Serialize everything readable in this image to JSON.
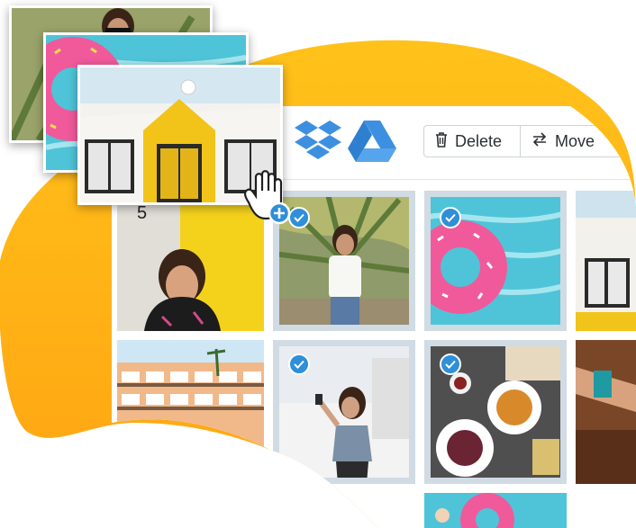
{
  "colors": {
    "blob_top": "#ffc21a",
    "blob_bottom": "#ffa412",
    "accent_blue": "#2f8fd8",
    "selection_border": "#d0dbe4",
    "toolbar_border": "#cfd3d6"
  },
  "toolbar": {
    "services": [
      {
        "name": "dropbox-icon"
      },
      {
        "name": "google-drive-icon"
      }
    ],
    "delete_label": "Delete",
    "delete_icon": "trash-icon",
    "move_label": "Move",
    "move_icon": "swap-arrows-icon"
  },
  "photos": [
    {
      "name": "photo-yellow-wall-woman",
      "selected": false,
      "label": "5"
    },
    {
      "name": "photo-palm-woman",
      "selected": true
    },
    {
      "name": "photo-pool-float",
      "selected": true
    },
    {
      "name": "photo-white-house",
      "selected": false
    },
    {
      "name": "photo-hotel-building",
      "selected": false
    },
    {
      "name": "photo-selfie-woman",
      "selected": true
    },
    {
      "name": "photo-food-table",
      "selected": true
    },
    {
      "name": "photo-bracelet-arm",
      "selected": false
    },
    {
      "name": "photo-pool-bottom",
      "selected": false
    }
  ],
  "drag_stack": [
    {
      "name": "drag-photo-palm-woman"
    },
    {
      "name": "drag-photo-pool-float"
    },
    {
      "name": "drag-photo-white-house"
    }
  ],
  "cursor": {
    "icon": "hand-grab-icon",
    "badge_icon": "plus-badge-icon"
  }
}
